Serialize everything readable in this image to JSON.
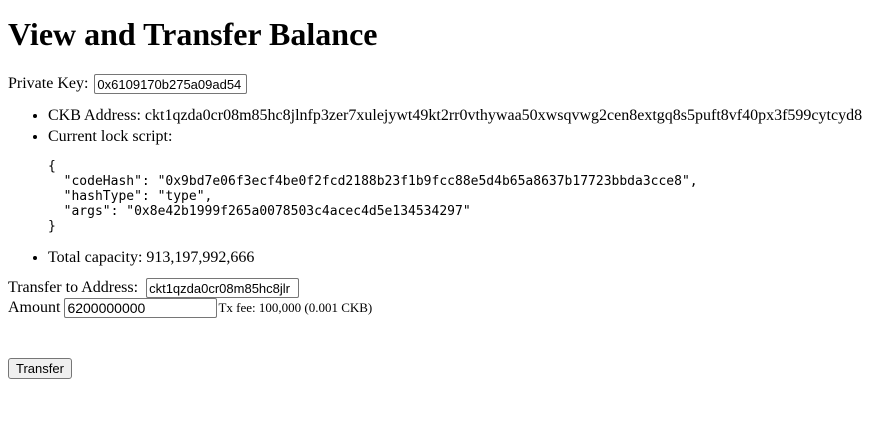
{
  "page": {
    "title": "View and Transfer Balance"
  },
  "private_key": {
    "label": "Private Key:",
    "value": "0x6109170b275a09ad54"
  },
  "info": {
    "ckb_address_label": "CKB Address:",
    "ckb_address": "ckt1qzda0cr08m85hc8jlnfp3zer7xulejywt49kt2rr0vthywaa50xwsqvwg2cen8extgq8s5puft8vf40px3f599cytcyd8",
    "lock_script_label": "Current lock script:",
    "lock_script": "{\n  \"codeHash\": \"0x9bd7e06f3ecf4be0f2fcd2188b23f1b9fcc88e5d4b65a8637b17723bbda3cce8\",\n  \"hashType\": \"type\",\n  \"args\": \"0x8e42b1999f265a0078503c4acec4d5e134534297\"\n}",
    "total_capacity_label": "Total capacity:",
    "total_capacity": "913,197,992,666"
  },
  "transfer": {
    "to_label": "Transfer to Address:",
    "to_value": "ckt1qzda0cr08m85hc8jlr",
    "amount_label": "Amount",
    "amount_value": "6200000000",
    "fee_text": "Tx fee: 100,000 (0.001 CKB)",
    "button_label": "Transfer"
  }
}
